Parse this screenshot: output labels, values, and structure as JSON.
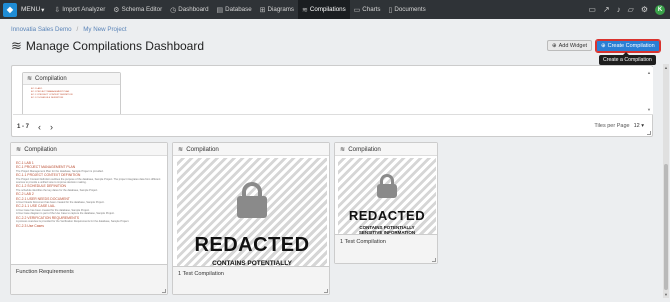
{
  "nav": {
    "logo": "◆",
    "menu_label": "MENU",
    "items": [
      {
        "label": "Import Analyzer",
        "icon": "⇩"
      },
      {
        "label": "Schema Editor",
        "icon": "⚙"
      },
      {
        "label": "Dashboard",
        "icon": "◷"
      },
      {
        "label": "Database",
        "icon": "▤"
      },
      {
        "label": "Diagrams",
        "icon": "⊞"
      },
      {
        "label": "Compilations",
        "icon": "≋"
      },
      {
        "label": "Charts",
        "icon": "▭"
      },
      {
        "label": "Documents",
        "icon": "▯"
      }
    ],
    "user_initial": "K"
  },
  "breadcrumb": {
    "item1": "Innovatia Sales Demo",
    "sep": "/",
    "item2": "My New Project"
  },
  "page": {
    "title": "Manage Compilations Dashboard"
  },
  "toolbar": {
    "add_widget": "Add Widget",
    "create_compilation": "Create Compilation",
    "tooltip": "Create a Compilation"
  },
  "carousel": {
    "card_title": "Compilation",
    "mini_lines": [
      "EC.1 LAB 1",
      "EC.1 PROJECT MANAGEMENT PLAN",
      "EC.1.1 PROJECT CONTEXT DEFINITION",
      "EC.1.2 SCHEDULE DEFINITION"
    ],
    "range": "1 - 7",
    "prev": "‹",
    "next": "›",
    "tiles_label": "Tiles per Page",
    "tiles_value": "12"
  },
  "widgets": [
    {
      "title": "Compilation",
      "footer": "Function Requirements",
      "doc_lines": [
        {
          "t": "EC.1 LAB 1",
          "sub": false
        },
        {
          "t": "EC.1 PROJECT MANAGEMENT PLAN",
          "sub": false
        },
        {
          "t": "The Project Management Plan for the database, Sample Project is provided.",
          "sub": true
        },
        {
          "t": "EC.1.1 PROJECT CONTEXT DEFINITION",
          "sub": false
        },
        {
          "t": "The Project Context Definition outlines the purpose of the database, Sample Project. The project integrates data from different",
          "sub": true
        },
        {
          "t": "sources to provide a unified view to improve decision making.",
          "sub": true
        },
        {
          "t": "EC.1.2 SCHEDULE DEFINITION",
          "sub": false
        },
        {
          "t": "The schedule identifies the key dates for the database, Sample Project.",
          "sub": true
        },
        {
          "t": "EC.2 LAB 2",
          "sub": false
        },
        {
          "t": "EC.2.1 USER NEEDS DOCUMENT",
          "sub": false
        },
        {
          "t": "A User Needs Document has been created for the database, Sample Project.",
          "sub": true
        },
        {
          "t": "EC.2.1.1 USE CASE LIAL",
          "sub": false
        },
        {
          "t": "A Use Case has been created for the database, Sample Project.",
          "sub": true
        },
        {
          "t": "A Use Case diagram is part of the Use Case to capture the database, Sample Project.",
          "sub": true
        },
        {
          "t": "EC.2.2 VERIFICATION REQUIREMENTS",
          "sub": false
        },
        {
          "t": "A process overview is provided for the Verification Requirements for the database, Sample Project.",
          "sub": true
        },
        {
          "t": "EC.2.3 Use Cases",
          "sub": false
        }
      ]
    },
    {
      "title": "Compilation",
      "footer": "1 Test Compilation",
      "redacted": "REDACTED",
      "redacted_sub": "CONTAINS POTENTIALLY"
    },
    {
      "title": "Compilation",
      "footer": "1 Test Compilation",
      "redacted": "REDACTED",
      "redacted_sub": "CONTAINS POTENTIALLY SENSITIVE INFORMATION"
    }
  ]
}
